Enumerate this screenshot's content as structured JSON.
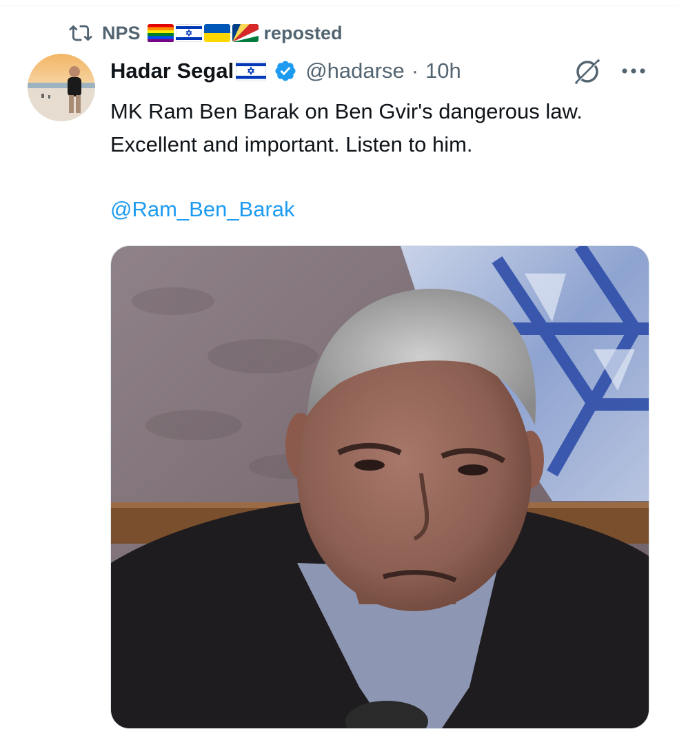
{
  "repost": {
    "icon": "repost-icon",
    "reposter_name": "NPS",
    "reposter_flags": [
      "rainbow-flag-icon",
      "israel-flag-icon",
      "ukraine-flag-icon",
      "seychelles-flag-icon"
    ],
    "suffix": "reposted"
  },
  "tweet": {
    "author_name": "Hadar Segal",
    "author_flag": "israel-flag-icon",
    "verified": true,
    "handle": "@hadarse",
    "separator": "·",
    "time": "10h",
    "text_lines": [
      "MK Ram Ben Barak on Ben Gvir's dangerous law.",
      "Excellent and important. Listen to him."
    ],
    "mention": "@Ram_Ben_Barak",
    "media_description_icon": "video-thumbnail"
  },
  "colors": {
    "text": "#0f1419",
    "secondary": "#536471",
    "link": "#1d9bf0",
    "verified": "#1d9bf0"
  }
}
